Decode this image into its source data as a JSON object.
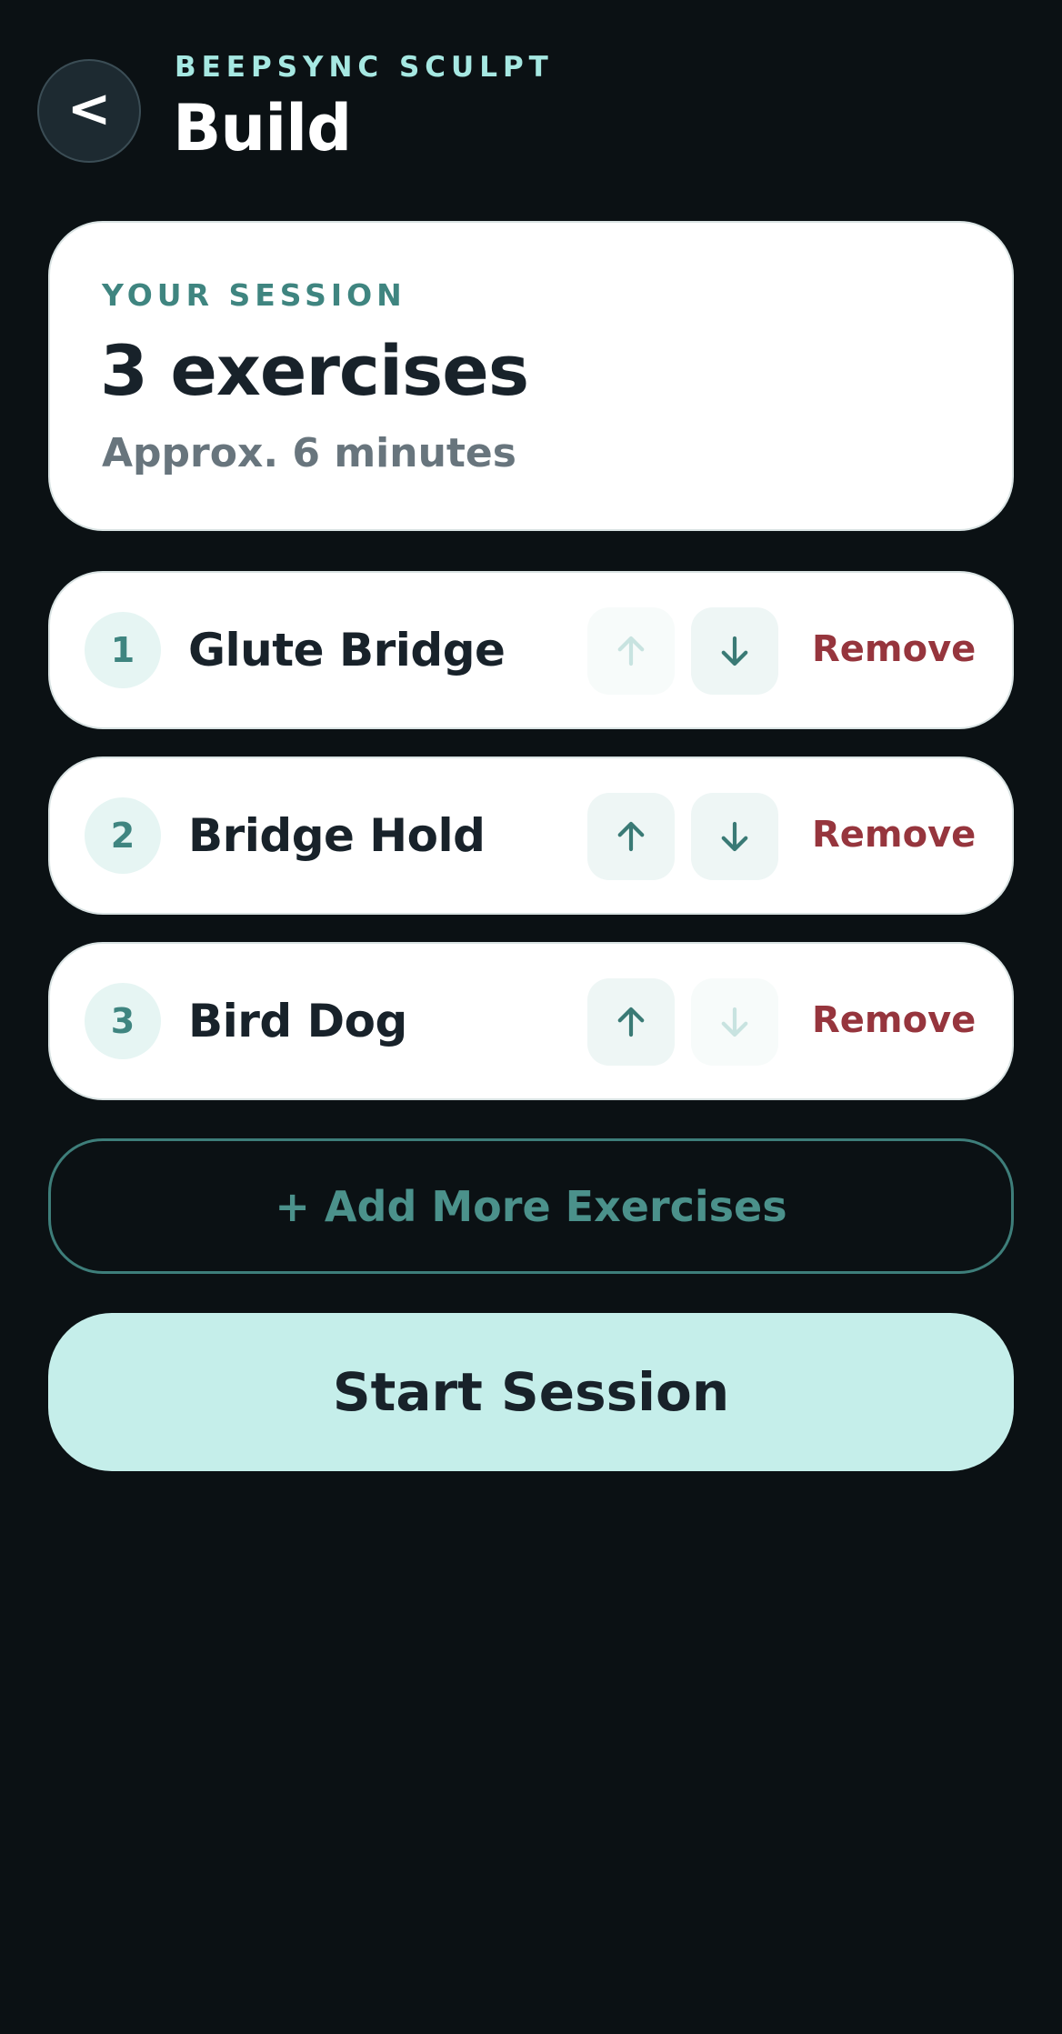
{
  "header": {
    "back_label": "<",
    "app_name": "BEEPSYNC SCULPT",
    "title": "Build"
  },
  "summary": {
    "label": "YOUR SESSION",
    "count": "3 exercises",
    "duration": "Approx. 6 minutes"
  },
  "exercises": [
    {
      "number": "1",
      "name": "Glute Bridge",
      "up_enabled": false,
      "down_enabled": true,
      "remove_label": "Remove"
    },
    {
      "number": "2",
      "name": "Bridge Hold",
      "up_enabled": true,
      "down_enabled": true,
      "remove_label": "Remove"
    },
    {
      "number": "3",
      "name": "Bird Dog",
      "up_enabled": true,
      "down_enabled": false,
      "remove_label": "Remove"
    }
  ],
  "actions": {
    "add_more_label": "+ Add More Exercises",
    "start_label": "Start Session"
  },
  "icons": {
    "move_up": "arrow-up-icon",
    "move_down": "arrow-down-icon"
  },
  "colors": {
    "background": "#0b1114",
    "accent": "#3f8580",
    "accent_light": "#c5eeea",
    "danger": "#96353d",
    "arrow_enabled": "#3a7a75",
    "arrow_disabled": "#c8e3e0"
  }
}
